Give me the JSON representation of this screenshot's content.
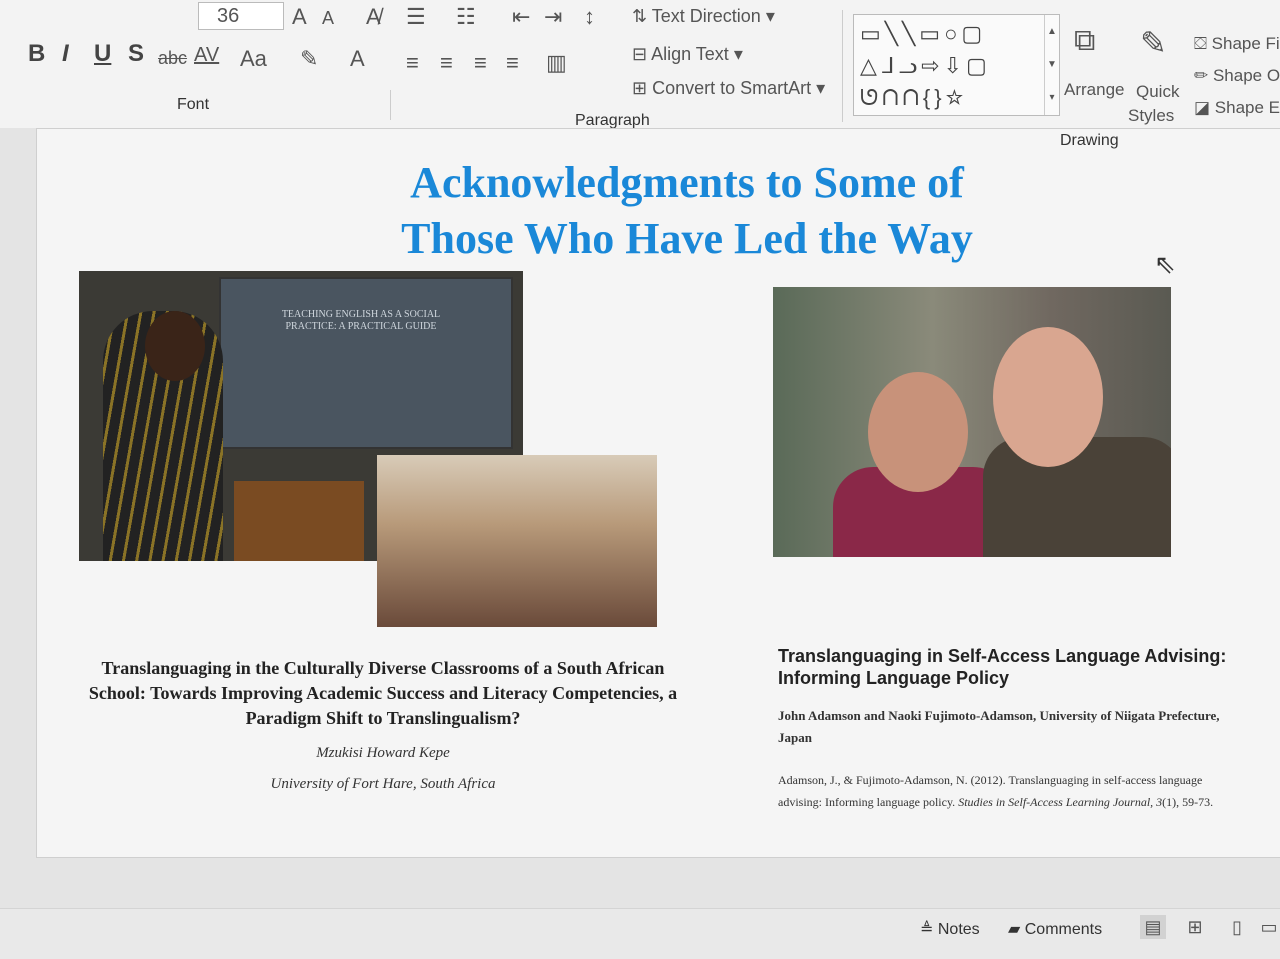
{
  "ribbon": {
    "font_size": "36",
    "font_group_label": "Font",
    "paragraph_group_label": "Paragraph",
    "drawing_group_label": "Drawing",
    "text_direction": "Text Direction",
    "align_text": "Align Text",
    "convert_smartart": "Convert to SmartArt",
    "arrange": "Arrange",
    "quick_styles_1": "Quick",
    "quick_styles_2": "Styles",
    "shape_fill": "Shape Fi",
    "shape_outline": "Shape O",
    "shape_effects": "Shape E",
    "bold": "B",
    "italic": "I",
    "underline": "U",
    "shadow": "S",
    "strike": "abc",
    "spacing": "AV",
    "change_case": "Aa",
    "grow_font": "A",
    "shrink_font": "A",
    "font_color": "A"
  },
  "slide": {
    "title_line1": "Acknowledgments to Some of",
    "title_line2": "Those Who Have Led the Way",
    "screen_text": "TEACHING ENGLISH AS A SOCIAL PRACTICE: A PRACTICAL GUIDE",
    "left": {
      "paper_title": "Translanguaging  in the  Culturally Diverse Classrooms  of a South African School: Towards Improving  Academic Success and Literacy Competencies, a Paradigm Shift to Translingualism?",
      "author": "Mzukisi Howard Kepe",
      "affiliation": "University of Fort Hare, South Africa"
    },
    "right": {
      "paper_title": "Translanguaging in Self-Access Language Advising: Informing Language Policy",
      "authors": "John Adamson and Naoki Fujimoto-Adamson, University of Niigata Prefecture, Japan",
      "citation_prefix": "Adamson, J., & Fujimoto-Adamson, N. (2012). Translanguaging in self-access language advising: Informing language policy. ",
      "citation_journal": "Studies in Self-Access Learning Journal, 3",
      "citation_suffix": "(1), 59-73."
    }
  },
  "statusbar": {
    "notes": "Notes",
    "comments": "Comments"
  },
  "colors": {
    "title": "#1a88d8",
    "ribbon_bg": "#f3f3f3",
    "slide_bg": "#f5f5f5"
  }
}
